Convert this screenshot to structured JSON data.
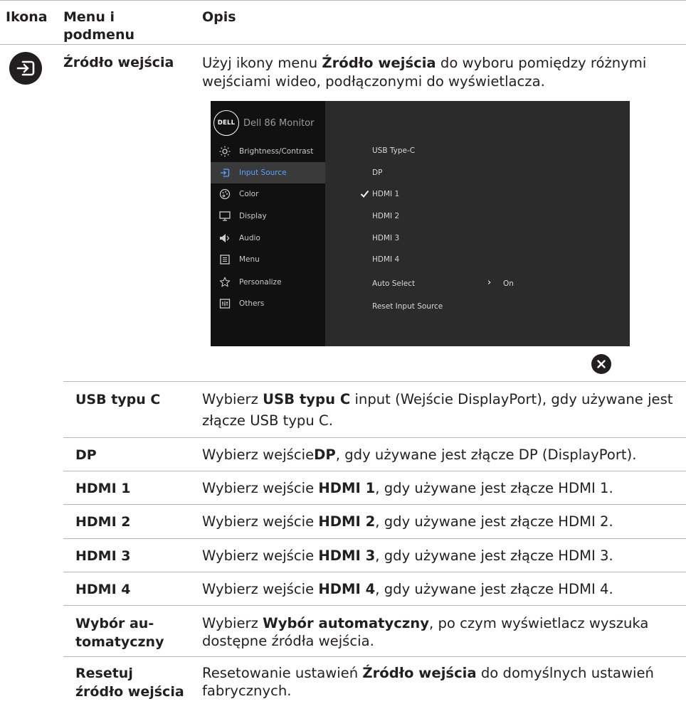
{
  "header": {
    "col_icon": "Ikona",
    "col_menu_line1": "Menu i",
    "col_menu_line2": "podmenu",
    "col_desc": "Opis"
  },
  "section": {
    "menu_name": "Źródło wejścia",
    "intro_pre": "Użyj ikony menu ",
    "intro_bold": "Źródło wejścia",
    "intro_post": " do wyboru pomiędzy różnymi wejściami wideo, podłączonymi do wyświetlacza."
  },
  "osd": {
    "brand": "DELL",
    "title": "Dell 86 Monitor",
    "menu": [
      {
        "label": "Brightness/Contrast",
        "icon": "brightness-icon"
      },
      {
        "label": "Input Source",
        "icon": "input-source-icon",
        "active": true
      },
      {
        "label": "Color",
        "icon": "color-palette-icon"
      },
      {
        "label": "Display",
        "icon": "display-icon"
      },
      {
        "label": "Audio",
        "icon": "speaker-icon"
      },
      {
        "label": "Menu",
        "icon": "menu-icon"
      },
      {
        "label": "Personalize",
        "icon": "star-icon"
      },
      {
        "label": "Others",
        "icon": "others-icon"
      }
    ],
    "options": [
      "USB Type-C",
      "DP",
      "HDMI 1",
      "HDMI 2",
      "HDMI 3",
      "HDMI 4",
      "Auto Select",
      "Reset Input Source"
    ],
    "selected": "HDMI 1",
    "auto_select_value": "On",
    "colors": {
      "panel": "#2b2b2b",
      "sidebar": "#111111",
      "active_text": "#5aa3ff"
    }
  },
  "rows": [
    {
      "name": "USB typu C",
      "pre": "Wybierz ",
      "bold": "USB typu C",
      "post": " input (Wejście DisplayPort), gdy używane jest złącze USB typu C."
    },
    {
      "name": "DP",
      "pre": "Wybierz wejście",
      "bold": "DP",
      "post": ", gdy używane jest złącze DP (DisplayPort)."
    },
    {
      "name": "HDMI 1",
      "pre": "Wybierz wejście ",
      "bold": "HDMI 1",
      "post": ", gdy używane jest złącze HDMI 1."
    },
    {
      "name": "HDMI 2",
      "pre": "Wybierz wejście ",
      "bold": "HDMI 2",
      "post": ", gdy używane jest złącze HDMI 2."
    },
    {
      "name": "HDMI 3",
      "pre": "Wybierz wejście ",
      "bold": "HDMI 3",
      "post": ", gdy używane jest złącze HDMI 3."
    },
    {
      "name": "HDMI 4",
      "pre": "Wybierz wejście ",
      "bold": "HDMI 4",
      "post": ", gdy używane jest złącze HDMI 4."
    },
    {
      "name_line1": "Wybór au-",
      "name_line2": "tomatyczny",
      "pre": "Wybierz ",
      "bold": "Wybór automatyczny",
      "post": ", po czym wyświetlacz wyszuka dostępne źródła wejścia."
    },
    {
      "name_line1": "Resetuj",
      "name_line2": "źródło wejścia",
      "pre": "Resetowanie ustawień ",
      "bold": "Źródło wejścia",
      "post": " do domyślnych ustawień fabrycznych."
    }
  ]
}
